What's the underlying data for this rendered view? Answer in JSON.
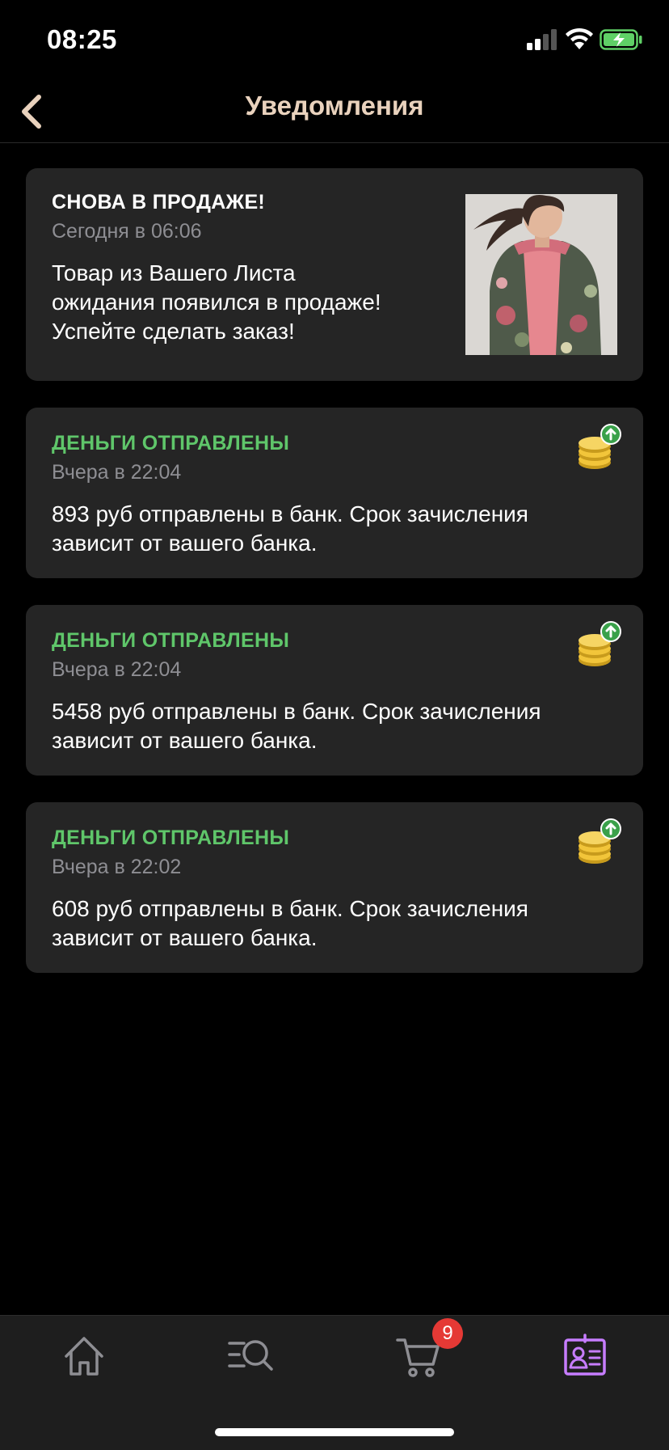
{
  "status_bar": {
    "time": "08:25"
  },
  "nav": {
    "title": "Уведомления"
  },
  "notifications": [
    {
      "title": "СНОВА В ПРОДАЖЕ!",
      "time": "Сегодня в 06:06",
      "body_lines": [
        "Товар из Вашего Листа",
        "ожидания появился в продаже!",
        "Успейте сделать заказ!"
      ],
      "icon": "product-photo"
    },
    {
      "title": "ДЕНЬГИ ОТПРАВЛЕНЫ",
      "time": "Вчера в 22:04",
      "body_lines": [
        "893 руб отправлены в банк. Срок зачисления",
        "зависит от вашего банка."
      ],
      "icon": "coins-icon"
    },
    {
      "title": "ДЕНЬГИ ОТПРАВЛЕНЫ",
      "time": "Вчера в 22:04",
      "body_lines": [
        "5458 руб отправлены в банк. Срок зачисления",
        "зависит от вашего банка."
      ],
      "icon": "coins-icon"
    },
    {
      "title": "ДЕНЬГИ ОТПРАВЛЕНЫ",
      "time": "Вчера в 22:02",
      "body_lines": [
        "608 руб отправлены в банк. Срок зачисления",
        "зависит от вашего банка."
      ],
      "icon": "coins-icon"
    }
  ],
  "tab_bar": {
    "tabs": [
      "home-icon",
      "search-icon",
      "cart-icon",
      "profile-icon"
    ],
    "active_tab": "profile-icon",
    "cart_badge": "9"
  },
  "colors": {
    "accent_title": "#e9d2bd",
    "money_title": "#5fc66a",
    "active_tab": "#c77dff",
    "badge": "#e53935"
  }
}
